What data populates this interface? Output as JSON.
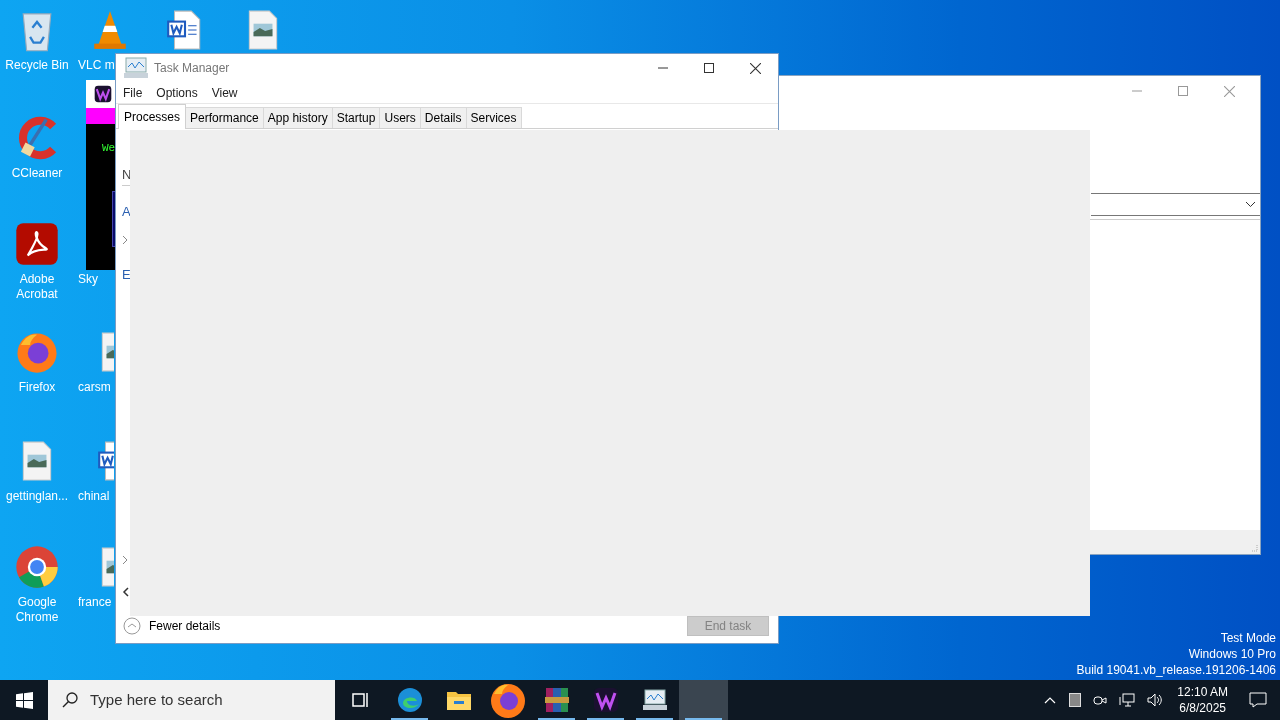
{
  "desktop": {
    "icons": [
      {
        "kind": "recycle-bin",
        "label": "Recycle Bin"
      },
      {
        "kind": "vlc",
        "label": "VLC m"
      },
      {
        "kind": "word-doc"
      },
      {
        "kind": "image-doc"
      },
      {
        "kind": "ccleaner",
        "label": "CCleaner"
      },
      {
        "kind": "acrobat",
        "label": "Adobe Acrobat"
      },
      {
        "kind": "hidden",
        "label": "Sky"
      },
      {
        "kind": "firefox",
        "label": "Firefox"
      },
      {
        "kind": "image-doc",
        "label": "carsm"
      },
      {
        "kind": "image-doc",
        "label": "gettinglan..."
      },
      {
        "kind": "word-doc",
        "label": "chinal"
      },
      {
        "kind": "chrome",
        "label": "Google Chrome"
      },
      {
        "kind": "image-doc",
        "label": "france"
      }
    ],
    "os_info": [
      "Test Mode",
      "Windows 10 Pro",
      "Build 19041.vb_release.191206-1406"
    ]
  },
  "background_app": {
    "text": "We"
  },
  "task_manager": {
    "title": "Task Manager",
    "menu": [
      "File",
      "Options",
      "View"
    ],
    "tabs": [
      {
        "label": "Processes",
        "selected": true
      },
      {
        "label": "Performance",
        "selected": false
      },
      {
        "label": "App history",
        "selected": false
      },
      {
        "label": "Startup",
        "selected": false
      },
      {
        "label": "Users",
        "selected": false
      },
      {
        "label": "Details",
        "selected": false
      },
      {
        "label": "Services",
        "selected": false
      }
    ],
    "column_header": "N",
    "group_labels": [
      "A",
      "E"
    ],
    "footer": {
      "toggle": "Fewer details",
      "button": {
        "label": "End task",
        "disabled": true
      }
    }
  },
  "taskbar": {
    "search": {
      "placeholder": "Type here to search"
    },
    "apps": [
      {
        "kind": "task-view",
        "running": false,
        "active": false
      },
      {
        "kind": "edge",
        "running": true,
        "active": false
      },
      {
        "kind": "explorer",
        "running": false,
        "active": false
      },
      {
        "kind": "firefox",
        "running": false,
        "active": false
      },
      {
        "kind": "winrar",
        "running": true,
        "active": false
      },
      {
        "kind": "w-app",
        "running": true,
        "active": false
      },
      {
        "kind": "task-manager",
        "running": true,
        "active": false
      },
      {
        "kind": "blank",
        "running": true,
        "active": true
      }
    ],
    "clock": {
      "time": "12:10 AM",
      "date": "6/8/2025"
    }
  }
}
